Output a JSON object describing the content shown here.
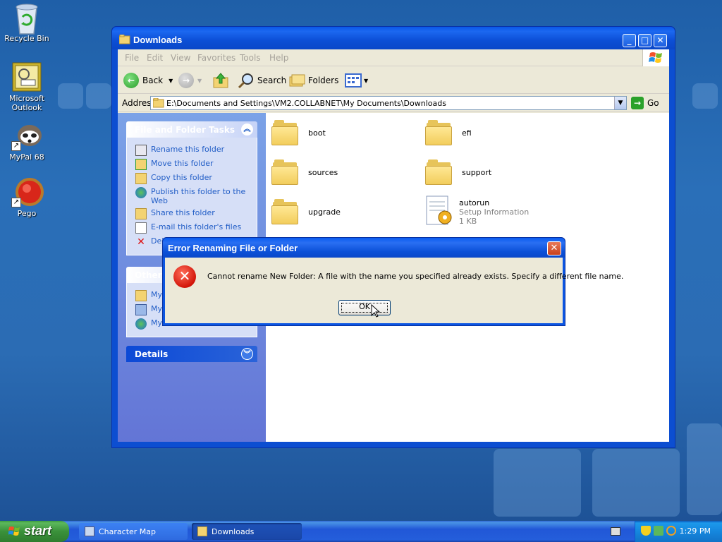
{
  "desktop": {
    "icons": [
      {
        "label": "Recycle Bin",
        "icon": "recycle-bin-icon"
      },
      {
        "label": "Microsoft Outlook",
        "icon": "outlook-icon"
      },
      {
        "label": "MyPal 68",
        "icon": "mypal-icon"
      },
      {
        "label": "Pego",
        "icon": "pego-icon"
      }
    ]
  },
  "window": {
    "title": "Downloads",
    "menu": [
      "File",
      "Edit",
      "View",
      "Favorites",
      "Tools",
      "Help"
    ],
    "toolbar": {
      "back": "Back",
      "search": "Search",
      "folders": "Folders"
    },
    "address": {
      "label": "Address",
      "value": "E:\\Documents and Settings\\VM2.COLLABNET\\My Documents\\Downloads",
      "go": "Go"
    },
    "tasks_panel": {
      "title": "File and Folder Tasks",
      "items": [
        "Rename this folder",
        "Move this folder",
        "Copy this folder",
        "Publish this folder to the Web",
        "Share this folder",
        "E-mail this folder's files",
        "Delete this folder"
      ]
    },
    "other_panel": {
      "title": "Other Places",
      "items": [
        "My Documents",
        "My Computer",
        "My Network Places"
      ]
    },
    "details_panel": {
      "title": "Details"
    },
    "files": [
      {
        "name": "boot",
        "type": "folder"
      },
      {
        "name": "efi",
        "type": "folder"
      },
      {
        "name": "sources",
        "type": "folder"
      },
      {
        "name": "support",
        "type": "folder"
      },
      {
        "name": "upgrade",
        "type": "folder"
      },
      {
        "name": "autorun",
        "type": "file",
        "desc": "Setup Information",
        "size": "1 KB"
      }
    ]
  },
  "dialog": {
    "title": "Error Renaming File or Folder",
    "message": "Cannot rename New Folder: A file with the name you specified already exists. Specify a different file name.",
    "ok": "OK"
  },
  "taskbar": {
    "start": "start",
    "tasks": [
      "Character Map",
      "Downloads"
    ],
    "clock": "1:29 PM"
  },
  "colors": {
    "desktop": "#2a6fb8",
    "title_bar": "#0c4fd6",
    "task_link": "#215dc6",
    "start_green": "#3a913a"
  }
}
